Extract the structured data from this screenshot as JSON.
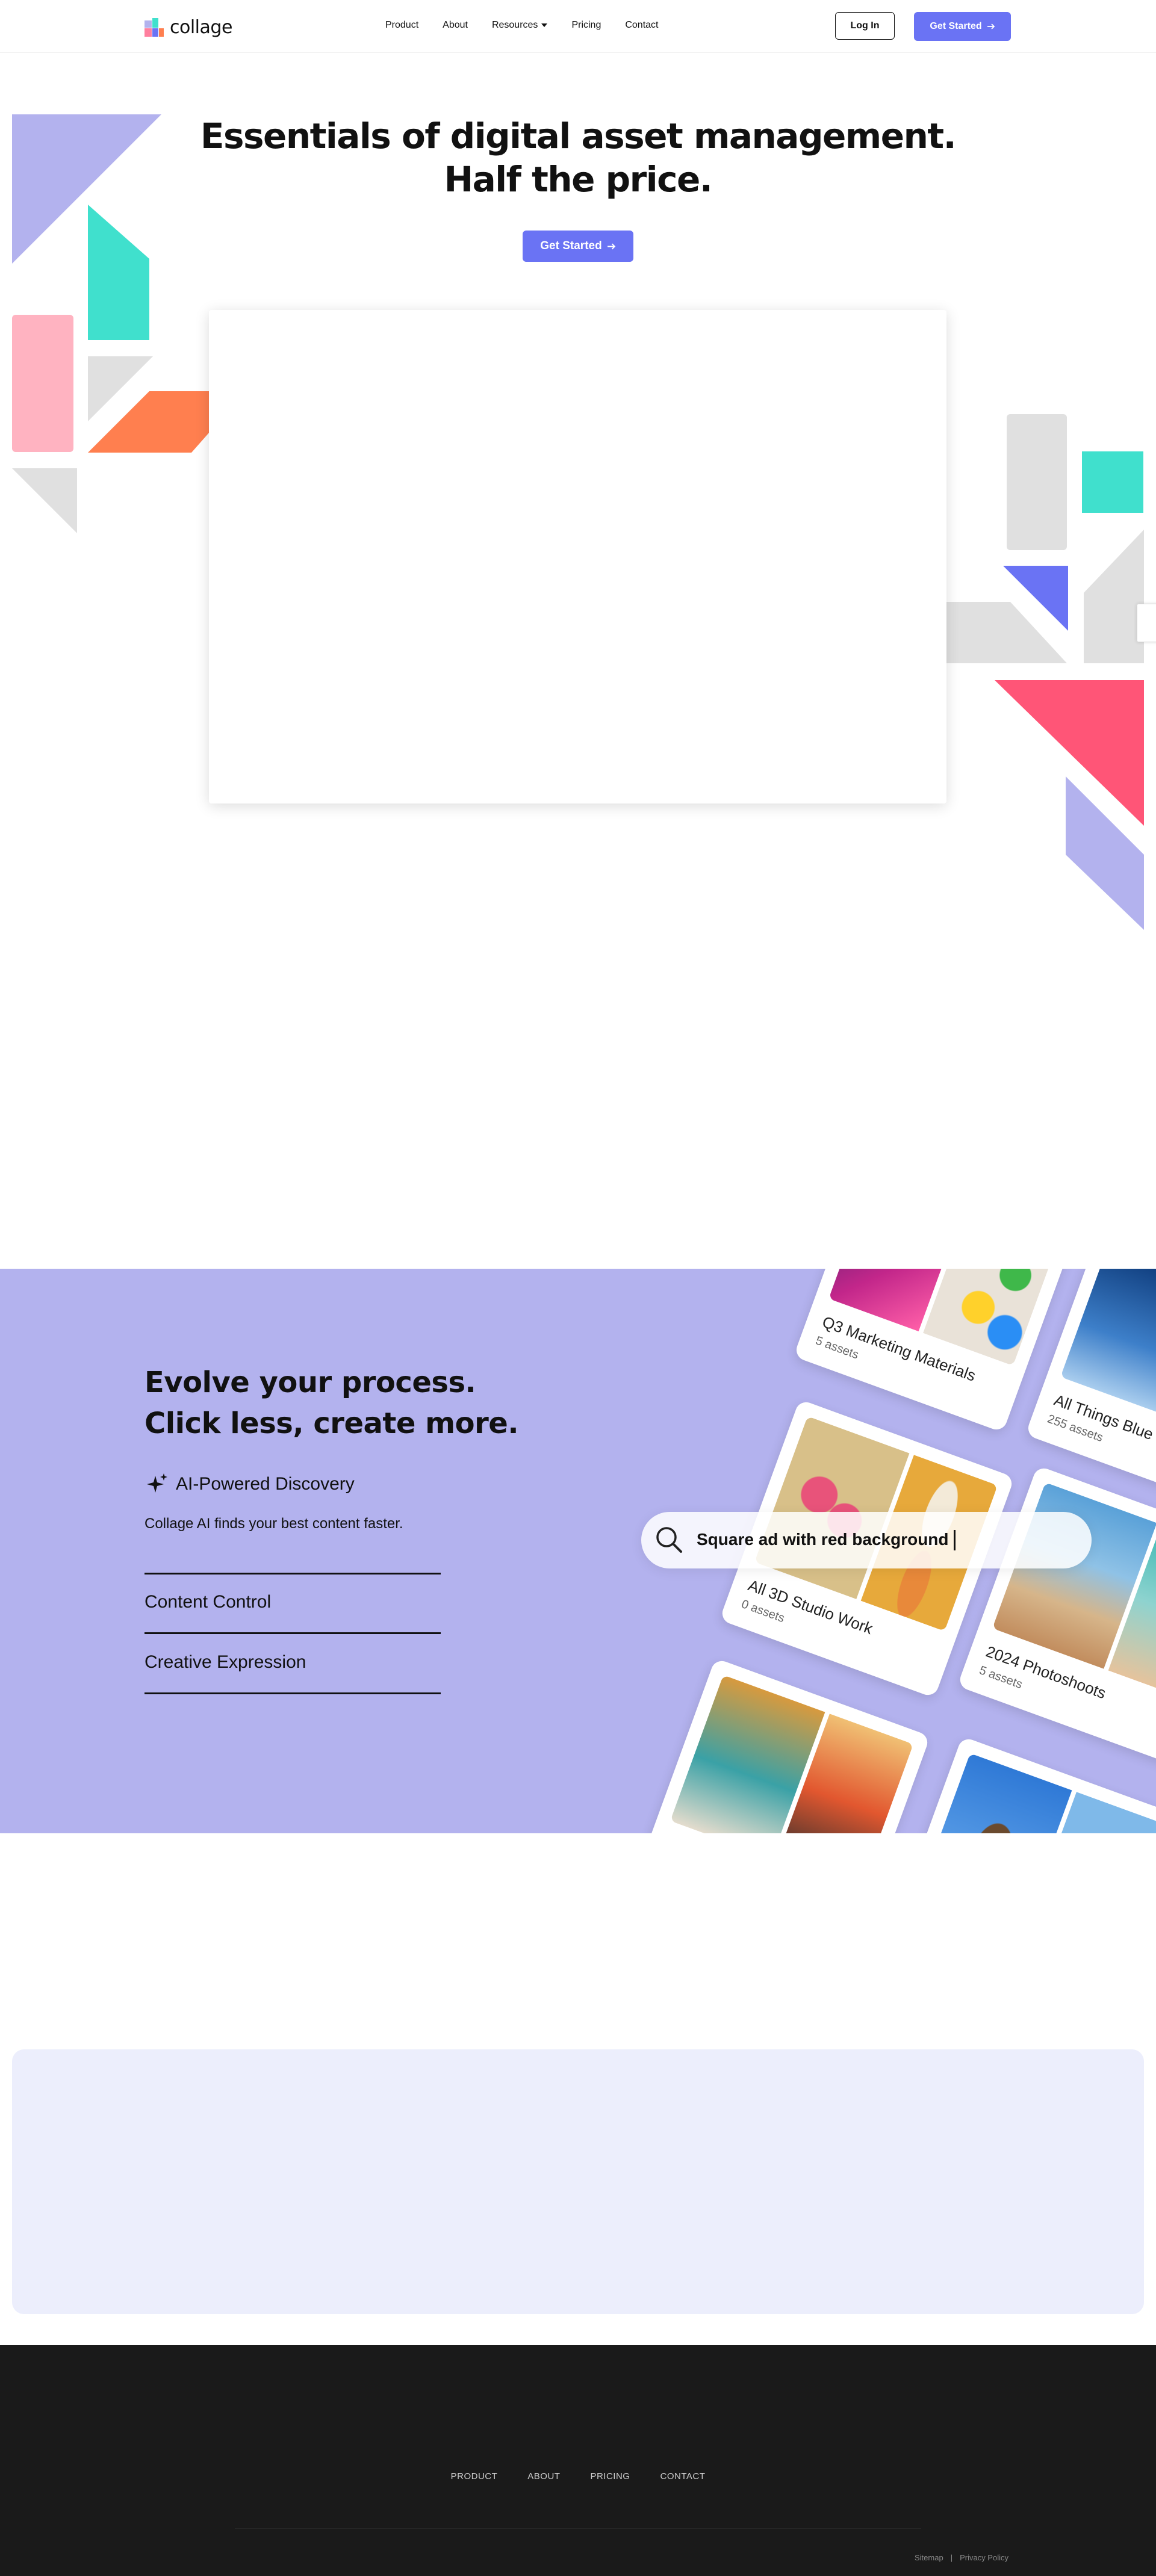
{
  "header": {
    "brand": "collage",
    "nav": [
      {
        "label": "Product"
      },
      {
        "label": "About"
      },
      {
        "label": "Resources",
        "dropdown": true
      },
      {
        "label": "Pricing"
      },
      {
        "label": "Contact"
      }
    ],
    "login_label": "Log In",
    "get_started_label": "Get Started"
  },
  "hero": {
    "title_line1": "Essentials of digital asset management.",
    "title_line2": "Half the price.",
    "cta_label": "Get Started"
  },
  "feature": {
    "title_line1": "Evolve your process.",
    "title_line2": "Click less, create more.",
    "active_item": "AI-Powered Discovery",
    "active_desc": "Collage AI finds your best content faster.",
    "items": [
      "Content Control",
      "Creative Expression"
    ],
    "search_query": "Square ad with red background",
    "cards": [
      {
        "name": "Q3 Marketing Materials",
        "count": "5 assets"
      },
      {
        "name": "All Things Blue",
        "count": "255 assets"
      },
      {
        "name": "All 3D Studio Work",
        "count": "0 assets"
      },
      {
        "name": "2024 Photoshoots",
        "count": "5 assets"
      },
      {
        "name": "",
        "count": ""
      },
      {
        "name": "",
        "count": ""
      }
    ]
  },
  "footer": {
    "nav": [
      "PRODUCT",
      "ABOUT",
      "PRICING",
      "CONTACT"
    ],
    "sitemap_label": "Sitemap",
    "separator": "|",
    "privacy_label": "Privacy Policy"
  },
  "colors": {
    "accent": "#6a73f4",
    "lavender": "#b3b2ee",
    "teal": "#40e0cd",
    "pink": "#ffb3c1",
    "orange": "#ff7f4f",
    "red": "#ff5577",
    "grey": "#e0e0e0",
    "panel": "#eceefc",
    "footer": "#1a1a1a"
  }
}
